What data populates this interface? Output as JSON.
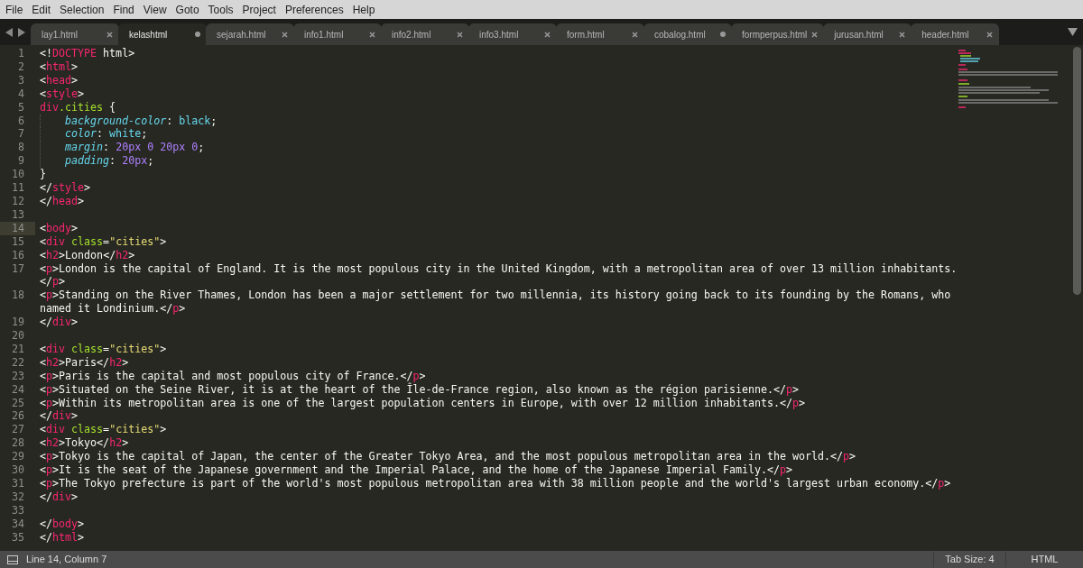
{
  "menu": [
    "File",
    "Edit",
    "Selection",
    "Find",
    "View",
    "Goto",
    "Tools",
    "Project",
    "Preferences",
    "Help"
  ],
  "tabs": [
    {
      "label": "lay1.html",
      "selected": false,
      "modified": false
    },
    {
      "label": "kelashtml",
      "selected": true,
      "modified": true
    },
    {
      "label": "sejarah.html",
      "selected": false,
      "modified": false
    },
    {
      "label": "info1.html",
      "selected": false,
      "modified": false
    },
    {
      "label": "info2.html",
      "selected": false,
      "modified": false
    },
    {
      "label": "info3.html",
      "selected": false,
      "modified": false
    },
    {
      "label": "form.html",
      "selected": false,
      "modified": false
    },
    {
      "label": "cobalog.html",
      "selected": false,
      "modified": true
    },
    {
      "label": "formperpus.html",
      "selected": false,
      "modified": false
    },
    {
      "label": "jurusan.html",
      "selected": false,
      "modified": false
    },
    {
      "label": "header.html",
      "selected": false,
      "modified": false
    }
  ],
  "lines": [
    {
      "number": "1",
      "current": false,
      "segments": [
        {
          "kind": "punct",
          "text": "<!"
        },
        {
          "kind": "tag",
          "text": "DOCTYPE"
        },
        {
          "kind": "text",
          "text": " html"
        },
        {
          "kind": "punct",
          "text": ">"
        }
      ]
    },
    {
      "number": "2",
      "current": false,
      "segments": [
        {
          "kind": "punct",
          "text": "<"
        },
        {
          "kind": "tag",
          "text": "html"
        },
        {
          "kind": "punct",
          "text": ">"
        }
      ]
    },
    {
      "number": "3",
      "current": false,
      "segments": [
        {
          "kind": "punct",
          "text": "<"
        },
        {
          "kind": "tag",
          "text": "head"
        },
        {
          "kind": "punct",
          "text": ">"
        }
      ]
    },
    {
      "number": "4",
      "current": false,
      "segments": [
        {
          "kind": "punct",
          "text": "<"
        },
        {
          "kind": "tag",
          "text": "style"
        },
        {
          "kind": "punct",
          "text": ">"
        }
      ]
    },
    {
      "number": "5",
      "current": false,
      "segments": [
        {
          "kind": "tag",
          "text": "div"
        },
        {
          "kind": "attr",
          "text": ".cities"
        },
        {
          "kind": "text",
          "text": " {"
        }
      ]
    },
    {
      "number": "6",
      "current": false,
      "segments": [
        {
          "kind": "indent"
        },
        {
          "kind": "prop",
          "text": "background-color"
        },
        {
          "kind": "punct",
          "text": ": "
        },
        {
          "kind": "value",
          "text": "black"
        },
        {
          "kind": "punct",
          "text": ";"
        }
      ]
    },
    {
      "number": "7",
      "current": false,
      "segments": [
        {
          "kind": "indent"
        },
        {
          "kind": "prop",
          "text": "color"
        },
        {
          "kind": "punct",
          "text": ": "
        },
        {
          "kind": "value",
          "text": "white"
        },
        {
          "kind": "punct",
          "text": ";"
        }
      ]
    },
    {
      "number": "8",
      "current": false,
      "segments": [
        {
          "kind": "indent"
        },
        {
          "kind": "prop",
          "text": "margin"
        },
        {
          "kind": "punct",
          "text": ": "
        },
        {
          "kind": "number",
          "text": "20"
        },
        {
          "kind": "number",
          "text": "px"
        },
        {
          "kind": "number",
          "text": " 0"
        },
        {
          "kind": "number",
          "text": " 20"
        },
        {
          "kind": "number",
          "text": "px"
        },
        {
          "kind": "number",
          "text": " 0"
        },
        {
          "kind": "punct",
          "text": ";"
        }
      ]
    },
    {
      "number": "9",
      "current": false,
      "segments": [
        {
          "kind": "indent"
        },
        {
          "kind": "prop",
          "text": "padding"
        },
        {
          "kind": "punct",
          "text": ": "
        },
        {
          "kind": "number",
          "text": "20"
        },
        {
          "kind": "number",
          "text": "px"
        },
        {
          "kind": "punct",
          "text": ";"
        }
      ]
    },
    {
      "number": "10",
      "current": false,
      "segments": [
        {
          "kind": "text",
          "text": "}"
        }
      ]
    },
    {
      "number": "11",
      "current": false,
      "segments": [
        {
          "kind": "punct",
          "text": "</"
        },
        {
          "kind": "tag",
          "text": "style"
        },
        {
          "kind": "punct",
          "text": ">"
        }
      ]
    },
    {
      "number": "12",
      "current": false,
      "segments": [
        {
          "kind": "punct",
          "text": "</"
        },
        {
          "kind": "tag",
          "text": "head"
        },
        {
          "kind": "punct",
          "text": ">"
        }
      ]
    },
    {
      "number": "13",
      "current": false
    },
    {
      "number": "14",
      "current": true,
      "segments": [
        {
          "kind": "punct",
          "text": "<"
        },
        {
          "kind": "tag",
          "text": "body"
        },
        {
          "kind": "punct",
          "text": ">"
        }
      ]
    },
    {
      "number": "15",
      "current": false,
      "segments": [
        {
          "kind": "punct",
          "text": "<"
        },
        {
          "kind": "tag",
          "text": "div"
        },
        {
          "kind": "attr",
          "text": " class"
        },
        {
          "kind": "punct",
          "text": "="
        },
        {
          "kind": "string",
          "text": "\"cities\""
        },
        {
          "kind": "punct",
          "text": ">"
        }
      ]
    },
    {
      "number": "16",
      "current": false,
      "segments": [
        {
          "kind": "punct",
          "text": "<"
        },
        {
          "kind": "tag",
          "text": "h2"
        },
        {
          "kind": "punct",
          "text": ">"
        },
        {
          "kind": "text",
          "text": "London"
        },
        {
          "kind": "punct",
          "text": "</"
        },
        {
          "kind": "tag",
          "text": "h2"
        },
        {
          "kind": "punct",
          "text": ">"
        }
      ]
    },
    {
      "number": "17",
      "current": false,
      "segments": [
        {
          "kind": "punct",
          "text": "<"
        },
        {
          "kind": "tag",
          "text": "p"
        },
        {
          "kind": "punct",
          "text": ">"
        },
        {
          "kind": "text",
          "text": "London is the capital of England. It is the most populous city in the United Kingdom, with a metropolitan area of over 13 million inhabitants."
        }
      ],
      "wrap": [
        {
          "kind": "punct",
          "text": "</"
        },
        {
          "kind": "tag",
          "text": "p"
        },
        {
          "kind": "punct",
          "text": ">"
        }
      ]
    },
    {
      "number": "18",
      "current": false,
      "segments": [
        {
          "kind": "punct",
          "text": "<"
        },
        {
          "kind": "tag",
          "text": "p"
        },
        {
          "kind": "punct",
          "text": ">"
        },
        {
          "kind": "text",
          "text": "Standing on the River Thames, London has been a major settlement for two millennia, its history going back to its founding by the Romans, who"
        }
      ],
      "wrap": [
        {
          "kind": "text",
          "text": "named it Londinium."
        },
        {
          "kind": "punct",
          "text": "</"
        },
        {
          "kind": "tag",
          "text": "p"
        },
        {
          "kind": "punct",
          "text": ">"
        }
      ]
    },
    {
      "number": "19",
      "current": false,
      "segments": [
        {
          "kind": "punct",
          "text": "</"
        },
        {
          "kind": "tag",
          "text": "div"
        },
        {
          "kind": "punct",
          "text": ">"
        }
      ]
    },
    {
      "number": "20",
      "current": false
    },
    {
      "number": "21",
      "current": false,
      "segments": [
        {
          "kind": "punct",
          "text": "<"
        },
        {
          "kind": "tag",
          "text": "div"
        },
        {
          "kind": "attr",
          "text": " class"
        },
        {
          "kind": "punct",
          "text": "="
        },
        {
          "kind": "string",
          "text": "\"cities\""
        },
        {
          "kind": "punct",
          "text": ">"
        }
      ]
    },
    {
      "number": "22",
      "current": false,
      "segments": [
        {
          "kind": "punct",
          "text": "<"
        },
        {
          "kind": "tag",
          "text": "h2"
        },
        {
          "kind": "punct",
          "text": ">"
        },
        {
          "kind": "text",
          "text": "Paris"
        },
        {
          "kind": "punct",
          "text": "</"
        },
        {
          "kind": "tag",
          "text": "h2"
        },
        {
          "kind": "punct",
          "text": ">"
        }
      ]
    },
    {
      "number": "23",
      "current": false,
      "segments": [
        {
          "kind": "punct",
          "text": "<"
        },
        {
          "kind": "tag",
          "text": "p"
        },
        {
          "kind": "punct",
          "text": ">"
        },
        {
          "kind": "text",
          "text": "Paris is the capital and most populous city of France."
        },
        {
          "kind": "punct",
          "text": "</"
        },
        {
          "kind": "tag",
          "text": "p"
        },
        {
          "kind": "punct",
          "text": ">"
        }
      ]
    },
    {
      "number": "24",
      "current": false,
      "segments": [
        {
          "kind": "punct",
          "text": "<"
        },
        {
          "kind": "tag",
          "text": "p"
        },
        {
          "kind": "punct",
          "text": ">"
        },
        {
          "kind": "text",
          "text": "Situated on the Seine River, it is at the heart of the Île-de-France region, also known as the région parisienne."
        },
        {
          "kind": "punct",
          "text": "</"
        },
        {
          "kind": "tag",
          "text": "p"
        },
        {
          "kind": "punct",
          "text": ">"
        }
      ]
    },
    {
      "number": "25",
      "current": false,
      "segments": [
        {
          "kind": "punct",
          "text": "<"
        },
        {
          "kind": "tag",
          "text": "p"
        },
        {
          "kind": "punct",
          "text": ">"
        },
        {
          "kind": "text",
          "text": "Within its metropolitan area is one of the largest population centers in Europe, with over 12 million inhabitants."
        },
        {
          "kind": "punct",
          "text": "</"
        },
        {
          "kind": "tag",
          "text": "p"
        },
        {
          "kind": "punct",
          "text": ">"
        }
      ]
    },
    {
      "number": "26",
      "current": false,
      "segments": [
        {
          "kind": "punct",
          "text": "</"
        },
        {
          "kind": "tag",
          "text": "div"
        },
        {
          "kind": "punct",
          "text": ">"
        }
      ]
    },
    {
      "number": "27",
      "current": false,
      "segments": [
        {
          "kind": "punct",
          "text": "<"
        },
        {
          "kind": "tag",
          "text": "div"
        },
        {
          "kind": "attr",
          "text": " class"
        },
        {
          "kind": "punct",
          "text": "="
        },
        {
          "kind": "string",
          "text": "\"cities\""
        },
        {
          "kind": "punct",
          "text": ">"
        }
      ]
    },
    {
      "number": "28",
      "current": false,
      "segments": [
        {
          "kind": "punct",
          "text": "<"
        },
        {
          "kind": "tag",
          "text": "h2"
        },
        {
          "kind": "punct",
          "text": ">"
        },
        {
          "kind": "text",
          "text": "Tokyo"
        },
        {
          "kind": "punct",
          "text": "</"
        },
        {
          "kind": "tag",
          "text": "h2"
        },
        {
          "kind": "punct",
          "text": ">"
        }
      ]
    },
    {
      "number": "29",
      "current": false,
      "segments": [
        {
          "kind": "punct",
          "text": "<"
        },
        {
          "kind": "tag",
          "text": "p"
        },
        {
          "kind": "punct",
          "text": ">"
        },
        {
          "kind": "text",
          "text": "Tokyo is the capital of Japan, the center of the Greater Tokyo Area, and the most populous metropolitan area in the world."
        },
        {
          "kind": "punct",
          "text": "</"
        },
        {
          "kind": "tag",
          "text": "p"
        },
        {
          "kind": "punct",
          "text": ">"
        }
      ]
    },
    {
      "number": "30",
      "current": false,
      "segments": [
        {
          "kind": "punct",
          "text": "<"
        },
        {
          "kind": "tag",
          "text": "p"
        },
        {
          "kind": "punct",
          "text": ">"
        },
        {
          "kind": "text",
          "text": "It is the seat of the Japanese government and the Imperial Palace, and the home of the Japanese Imperial Family."
        },
        {
          "kind": "punct",
          "text": "</"
        },
        {
          "kind": "tag",
          "text": "p"
        },
        {
          "kind": "punct",
          "text": ">"
        }
      ]
    },
    {
      "number": "31",
      "current": false,
      "segments": [
        {
          "kind": "punct",
          "text": "<"
        },
        {
          "kind": "tag",
          "text": "p"
        },
        {
          "kind": "punct",
          "text": ">"
        },
        {
          "kind": "text",
          "text": "The Tokyo prefecture is part of the world's most populous metropolitan area with 38 million people and the world's largest urban economy."
        },
        {
          "kind": "punct",
          "text": "</"
        },
        {
          "kind": "tag",
          "text": "p"
        },
        {
          "kind": "punct",
          "text": ">"
        }
      ]
    },
    {
      "number": "32",
      "current": false,
      "segments": [
        {
          "kind": "punct",
          "text": "</"
        },
        {
          "kind": "tag",
          "text": "div"
        },
        {
          "kind": "punct",
          "text": ">"
        }
      ]
    },
    {
      "number": "33",
      "current": false
    },
    {
      "number": "34",
      "current": false,
      "segments": [
        {
          "kind": "punct",
          "text": "</"
        },
        {
          "kind": "tag",
          "text": "body"
        },
        {
          "kind": "punct",
          "text": ">"
        }
      ]
    },
    {
      "number": "35",
      "current": false,
      "segments": [
        {
          "kind": "punct",
          "text": "</"
        },
        {
          "kind": "tag",
          "text": "html"
        },
        {
          "kind": "punct",
          "text": ">"
        }
      ]
    }
  ],
  "status_bar": {
    "position": "Line 14, Column 7",
    "tab_size": "Tab Size: 4",
    "syntax": "HTML"
  }
}
